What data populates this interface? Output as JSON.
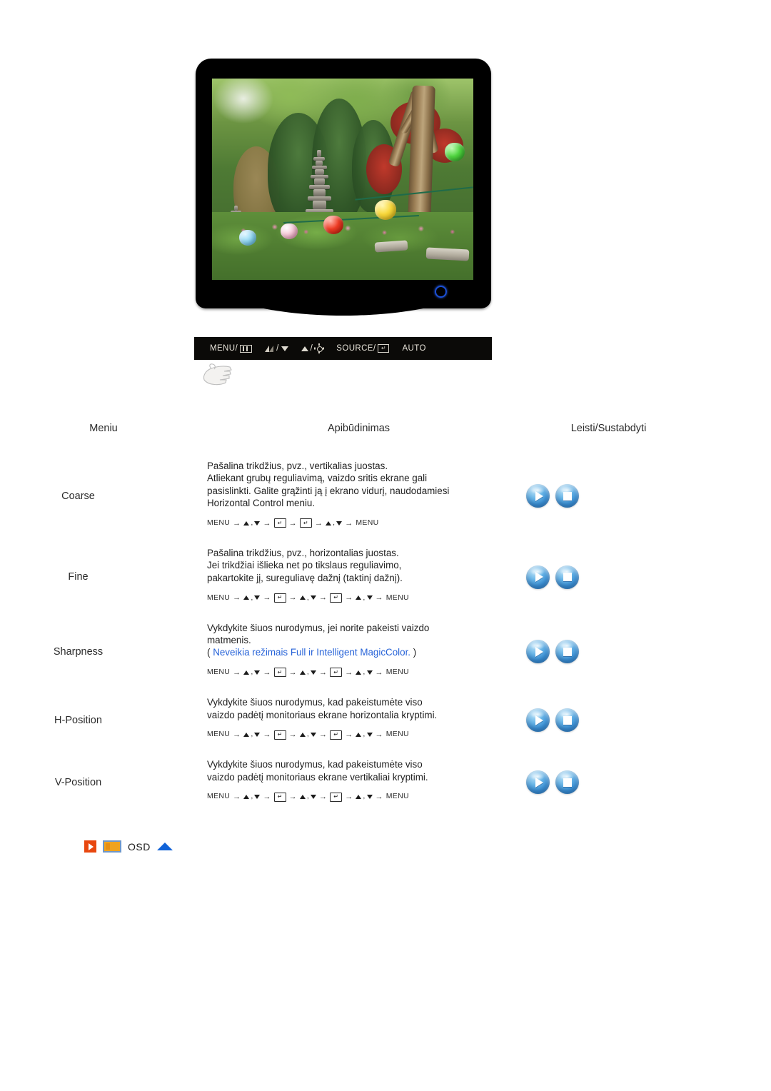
{
  "monitor": {
    "alt": "LCD monitor displaying a garden photo with stone pagoda and paper lanterns",
    "power_led_name": "power-indicator",
    "control_bar": {
      "buttons": [
        {
          "label": "MENU/",
          "icon": "osd-menu-icon"
        },
        {
          "label": "/",
          "icon_left": "contrast-icon",
          "icon_right": "down-arrow-icon"
        },
        {
          "label": "/",
          "icon_left": "up-arrow-icon",
          "icon_right": "brightness-icon"
        },
        {
          "label": "SOURCE/",
          "icon": "enter-key-icon"
        },
        {
          "label": "AUTO",
          "icon": ""
        }
      ],
      "menu_label": "MENU/",
      "source_label": "SOURCE/",
      "auto_label": "AUTO",
      "slash": "/"
    }
  },
  "table": {
    "headers": {
      "menu": "Meniu",
      "description": "Apibūdinimas",
      "play_stop": "Leisti/Sustabdyti"
    },
    "rows": [
      {
        "menu": "Coarse",
        "lines": [
          "Pašalina trikdžius, pvz., vertikalias juostas.",
          "Atliekant grubų reguliavimą, vaizdo sritis ekrane gali",
          "pasislinkti. Galite grąžinti ją į ekrano vidurį, naudodamiesi",
          "Horizontal Control meniu."
        ],
        "note": null,
        "sequence": [
          "MENU",
          "UD",
          "ENTER",
          "ENTER",
          "UD",
          "MENU"
        ]
      },
      {
        "menu": "Fine",
        "lines": [
          "Pašalina trikdžius, pvz., horizontalias juostas.",
          "Jei trikdžiai išlieka net po tikslaus reguliavimo,",
          "pakartokite jį, sureguliavę dažnį (taktinį dažnį)."
        ],
        "note": null,
        "sequence": [
          "MENU",
          "UD",
          "ENTER",
          "UD",
          "ENTER",
          "UD",
          "MENU"
        ]
      },
      {
        "menu": "Sharpness",
        "lines": [
          "Vykdykite šiuos nurodymus, jei norite pakeisti vaizdo",
          "matmenis."
        ],
        "note": {
          "open": "( ",
          "text": "Neveikia režimais Full ir Intelligent MagicColor.",
          "close": " )",
          "color": "#2763d8"
        },
        "sequence": [
          "MENU",
          "UD",
          "ENTER",
          "UD",
          "ENTER",
          "UD",
          "MENU"
        ]
      },
      {
        "menu": "H-Position",
        "lines": [
          "Vykdykite šiuos nurodymus, kad pakeistumėte viso",
          "vaizdo padėtį monitoriaus ekrane horizontalia kryptimi."
        ],
        "note": null,
        "sequence": [
          "MENU",
          "UD",
          "ENTER",
          "UD",
          "ENTER",
          "UD",
          "MENU"
        ]
      },
      {
        "menu": "V-Position",
        "lines": [
          "Vykdykite šiuos nurodymus, kad pakeistumėte viso",
          "vaizdo padėtį monitoriaus ekrane vertikaliai kryptimi."
        ],
        "note": null,
        "sequence": [
          "MENU",
          "UD",
          "ENTER",
          "UD",
          "ENTER",
          "UD",
          "MENU"
        ]
      }
    ],
    "sequence_tokens": {
      "menu": "MENU",
      "arrow": "→",
      "comma": ",",
      "enter_glyph": "↵"
    }
  },
  "footer": {
    "prev_button": "previous-page-button",
    "osd_icon": "osd-section-icon",
    "label": "OSD",
    "up_button": "scroll-up-button",
    "colors": {
      "prev_orange": "#e8470f",
      "osd_amber": "#f0a31e",
      "osd_border_blue": "#6f97c8",
      "up_blue": "#1163d8"
    }
  }
}
